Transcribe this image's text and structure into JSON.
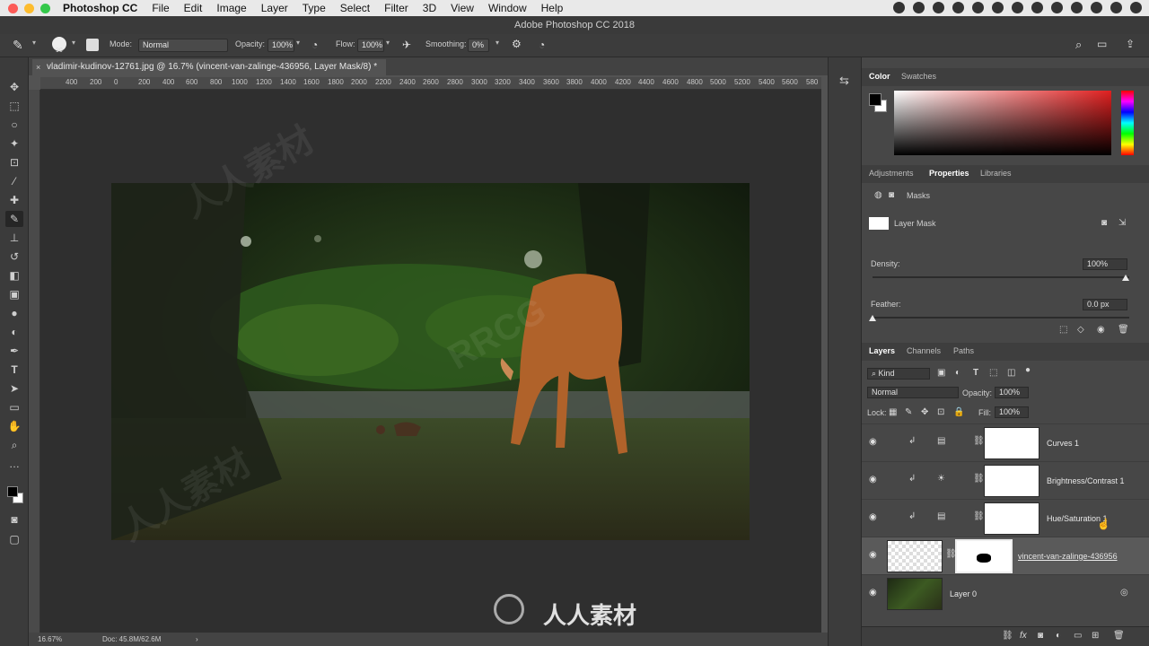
{
  "menubar": {
    "app_name": "Photoshop CC",
    "items": [
      "File",
      "Edit",
      "Image",
      "Layer",
      "Type",
      "Select",
      "Filter",
      "3D",
      "View",
      "Window",
      "Help"
    ]
  },
  "window": {
    "title": "Adobe Photoshop CC 2018"
  },
  "options": {
    "brush_size": "90",
    "mode_label": "Mode:",
    "mode_value": "Normal",
    "opacity_label": "Opacity:",
    "opacity_value": "100%",
    "flow_label": "Flow:",
    "flow_value": "100%",
    "smoothing_label": "Smoothing:",
    "smoothing_value": "0%"
  },
  "document": {
    "tab_title": "vladimir-kudinov-12761.jpg @ 16.7% (vincent-van-zalinge-436956, Layer Mask/8) *",
    "ruler_marks": [
      "400",
      "200",
      "0",
      "200",
      "400",
      "600",
      "800",
      "1000",
      "1200",
      "1400",
      "1600",
      "1800",
      "2000",
      "2200",
      "2400",
      "2600",
      "2800",
      "3000",
      "3200",
      "3400",
      "3600",
      "3800",
      "4000",
      "4200",
      "4400",
      "4600",
      "4800",
      "5000",
      "5200",
      "5400",
      "5600",
      "580"
    ],
    "zoom": "16.67%",
    "doc_info": "Doc: 45.8M/62.6M"
  },
  "color_panel": {
    "tabs": [
      "Color",
      "Swatches"
    ]
  },
  "properties_panel": {
    "tabs": [
      "Adjustments",
      "Properties",
      "Libraries"
    ],
    "active_tab": "Properties",
    "section_label": "Masks",
    "mask_label": "Layer Mask",
    "density_label": "Density:",
    "density_value": "100%",
    "feather_label": "Feather:",
    "feather_value": "0.0 px"
  },
  "layers_panel": {
    "tabs": [
      "Layers",
      "Channels",
      "Paths"
    ],
    "kind_label": "Kind",
    "blend_mode": "Normal",
    "opacity_label": "Opacity:",
    "opacity_value": "100%",
    "lock_label": "Lock:",
    "fill_label": "Fill:",
    "fill_value": "100%",
    "layers": [
      {
        "name": "Curves 1"
      },
      {
        "name": "Brightness/Contrast 1"
      },
      {
        "name": "Hue/Saturation 1"
      },
      {
        "name": "vincent-van-zalinge-436956"
      },
      {
        "name": "Layer 0"
      }
    ],
    "footer_fx": "fx"
  },
  "watermark": {
    "text": "人人素材",
    "brand": "RRCG"
  },
  "colors": {
    "accent_red": "#e02020",
    "foreground": "#000000",
    "background": "#ffffff"
  }
}
